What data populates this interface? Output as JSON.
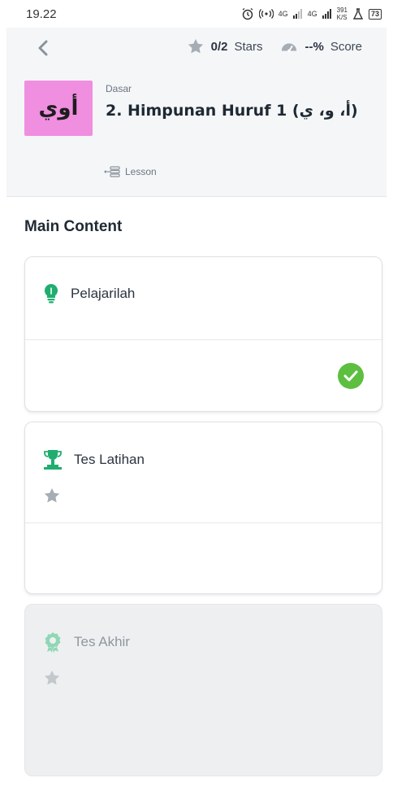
{
  "status_bar": {
    "time": "19.22",
    "network_labels": [
      "4G",
      "4G"
    ],
    "speed": "391",
    "speed_unit": "K/S",
    "battery": "73"
  },
  "header": {
    "stars_value": "0/2",
    "stars_label": "Stars",
    "score_value": "--%",
    "score_label": "Score",
    "thumbnail_text": "أوي",
    "level": "Dasar",
    "title": "2. Himpunan Huruf 1 (أ، و، ي)",
    "tag": "Lesson"
  },
  "main": {
    "section_title": "Main Content",
    "cards": [
      {
        "title": "Pelajarilah",
        "icon": "lightbulb-icon",
        "icon_color": "#1fae6f",
        "completed": true
      },
      {
        "title": "Tes Latihan",
        "icon": "trophy-icon",
        "icon_color": "#1fae6f",
        "stars": 1
      },
      {
        "title": "Tes Akhir",
        "icon": "award-badge-icon",
        "icon_color": "#8fd7b5",
        "stars": 1,
        "locked": true
      }
    ]
  },
  "colors": {
    "accent_green": "#1fae6f",
    "check_green": "#5cbf3f",
    "thumbnail_pink": "#f08ee0",
    "star_gray": "#a7adb4"
  }
}
